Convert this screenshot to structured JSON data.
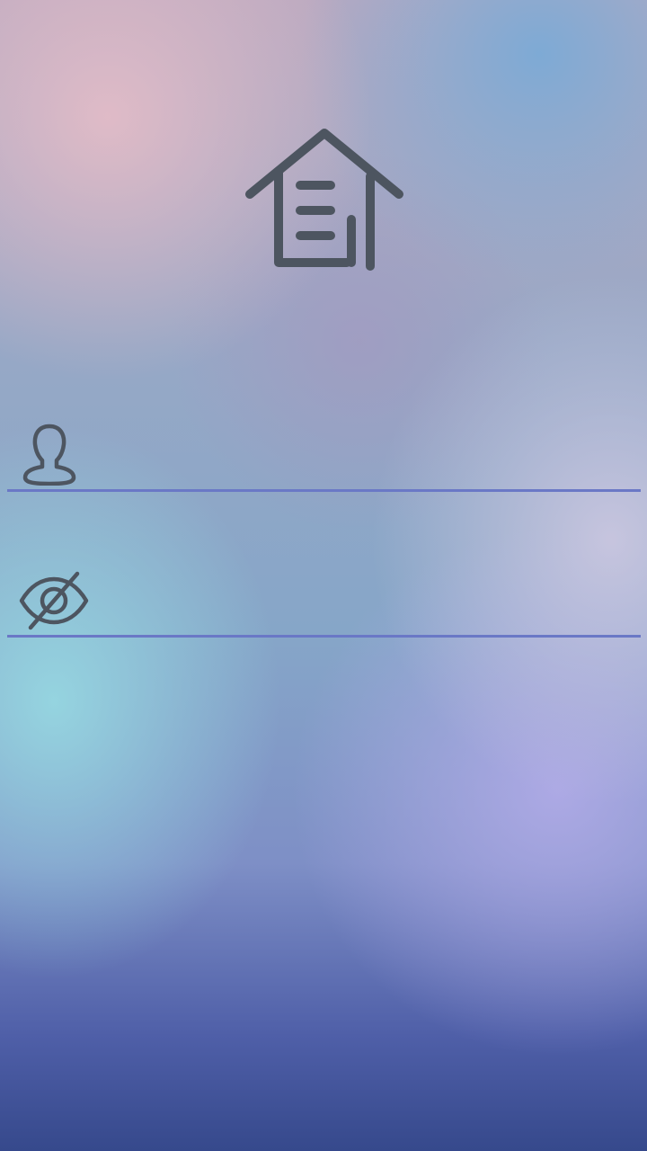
{
  "app": {
    "logo_icon": "house-document-icon",
    "icon_color": "#4d5560",
    "underline_color": "#6a78c6"
  },
  "login": {
    "username": {
      "icon": "user-icon",
      "value": "",
      "placeholder": ""
    },
    "password": {
      "icon": "eye-off-icon",
      "value": "",
      "placeholder": ""
    }
  }
}
